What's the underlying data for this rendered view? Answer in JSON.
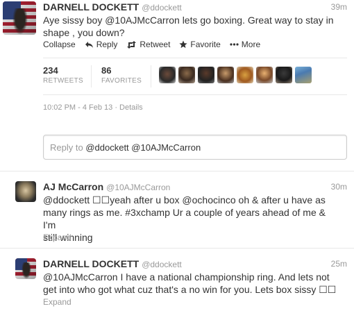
{
  "main_tweet": {
    "name": "DARNELL DOCKETT",
    "handle": "@ddockett",
    "time": "39m",
    "text_line1": "Aye sissy boy @10AJMcCarron lets go boxing. Great way to stay in",
    "text_line2": "shape , you down?",
    "actions": {
      "collapse": "Collapse",
      "reply": "Reply",
      "retweet": "Retweet",
      "favorite": "Favorite",
      "more": "More"
    },
    "stats": {
      "retweets_count": "234",
      "retweets_label": "RETWEETS",
      "favorites_count": "86",
      "favorites_label": "FAVORITES"
    },
    "datetime": "10:02 PM - 4 Feb 13 · Details"
  },
  "reply_box": {
    "prefix": "Reply to",
    "value": "@ddockett @10AJMcCarron"
  },
  "replies": [
    {
      "name": "AJ McCarron",
      "handle": "@10AJMcCarron",
      "time": "30m",
      "line1": "@ddockett ☐☐yeah after u box @ochocinco oh & after u have as",
      "line2": "many rings as me. #3xchamp Ur a couple of years ahead of me & I'm",
      "line3": "still winning",
      "expand": "Expand"
    },
    {
      "name": "DARNELL DOCKETT",
      "handle": "@ddockett",
      "time": "25m",
      "line1": "@10AJMcCarron I have a national championship ring. And lets not",
      "line2": "get into who got what cuz that's a no win for you. Lets box sissy ☐☐",
      "expand": "Expand"
    }
  ],
  "icons": {
    "reply": "reply-arrow-icon",
    "retweet": "retweet-icon",
    "favorite": "star-icon",
    "more": "more-dots-icon"
  }
}
